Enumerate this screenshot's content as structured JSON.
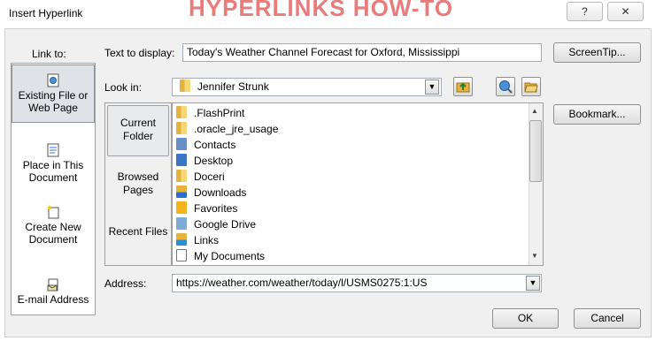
{
  "window": {
    "title": "Insert Hyperlink",
    "banner_text": "HYPERLINKS HOW-TO",
    "help_glyph": "?",
    "close_glyph": "✕"
  },
  "link_to": {
    "label": "Link to:",
    "items": [
      {
        "label": "Existing File or Web Page",
        "icon": "web-page-icon",
        "selected": true
      },
      {
        "label": "Place in This Document",
        "icon": "document-place-icon",
        "selected": false
      },
      {
        "label": "Create New Document",
        "icon": "new-document-icon",
        "selected": false
      },
      {
        "label": "E-mail Address",
        "icon": "email-icon",
        "selected": false
      }
    ]
  },
  "text_to_display": {
    "label": "Text to display:",
    "value": "Today's Weather Channel Forecast for Oxford, Mississippi"
  },
  "screentip_button": "ScreenTip...",
  "look_in": {
    "label": "Look in:",
    "value": "Jennifer Strunk"
  },
  "browse": {
    "items": [
      {
        "label": "Current Folder",
        "selected": true
      },
      {
        "label": "Browsed Pages",
        "selected": false
      },
      {
        "label": "Recent Files",
        "selected": false
      }
    ]
  },
  "files": [
    ".FlashPrint",
    ".oracle_jre_usage",
    "Contacts",
    "Desktop",
    "Doceri",
    "Downloads",
    "Favorites",
    "Google Drive",
    "Links",
    "My Documents"
  ],
  "bookmark_button": "Bookmark...",
  "address": {
    "label": "Address:",
    "value": "https://weather.com/weather/today/l/USMS0275:1:US"
  },
  "ok_button": "OK",
  "cancel_button": "Cancel",
  "colors": {
    "banner": "#e76d6d",
    "dialog_bg": "#f0f0f0",
    "selected_item": "#dfe3e8"
  }
}
